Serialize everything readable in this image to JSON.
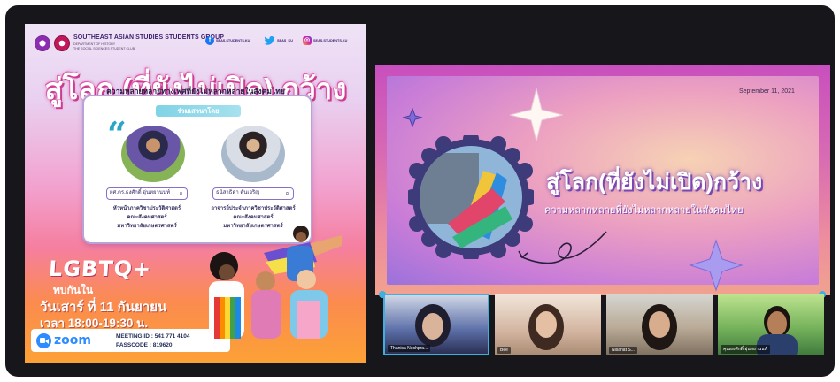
{
  "poster": {
    "org_name": "SOUTHEAST ASIAN STUDIES STUDENTS GROUP",
    "org_sub_1": "DEPARTMENT OF HISTORY",
    "org_sub_2": "THE SOCIAL SCIENCES STUDENT CLUB",
    "facebook_handle": "SEAS.STUDENTS.KU",
    "twitter_handle": "SEAS_KU",
    "instagram_handle": "SEAS.STUDENTS.KU",
    "title": "สู่โลก (ที่ยังไม่เปิด) กว้าง",
    "subtitle": "ความหลายหลายทางเพศที่ยังไม่หลากหลายในสังคมไทย",
    "join_banner": "ร่วมเสวนาโดย",
    "speaker_1_name": "ผศ.ดร.ธงศักดิ์ อุ่นหยานนท์",
    "speaker_1_role": [
      "หัวหน้าภาควิชาประวัติศาสตร์",
      "คณะสังคมศาสตร์",
      "มหาวิทยาลัยเกษตรศาสตร์"
    ],
    "speaker_2_name": "ธนิสาธิดา ตันเจริญ",
    "speaker_2_role": [
      "อาจารย์ประจำภาควิชาประวัติศาสตร์",
      "คณะสังคมศาสตร์",
      "มหาวิทยาลัยเกษตรศาสตร์"
    ],
    "lgbtq": "LGBTQ+",
    "meet_line_1": "พบกันใน",
    "meet_line_2": "วันเสาร์ ที่ 11 กันยายน",
    "meet_line_3": "เวลา 18:00-19:30 น.",
    "zoom_word": "zoom",
    "meeting_id": "MEETING ID : 541 771 4104",
    "passcode": "PASSCODE : 819620"
  },
  "zoom_call": {
    "slide_date": "September 11, 2021",
    "slide_title": "สู่โลก(ที่ยังไม่เปิด)กว้าง",
    "slide_subtitle": "ความหลากหลายที่ยังไม่หลากหลายในสังคมไทย",
    "participants": [
      {
        "label": "Thanisa Nuchpra..."
      },
      {
        "label": "Bee"
      },
      {
        "label": "Nisanat S..."
      },
      {
        "label": "คุณธงศักดิ์ อุ่นหยานนท์"
      }
    ]
  },
  "colors": {
    "frame": "#17171b",
    "active_speaker": "#3db0e0",
    "zoom_blue": "#2d8cff"
  }
}
